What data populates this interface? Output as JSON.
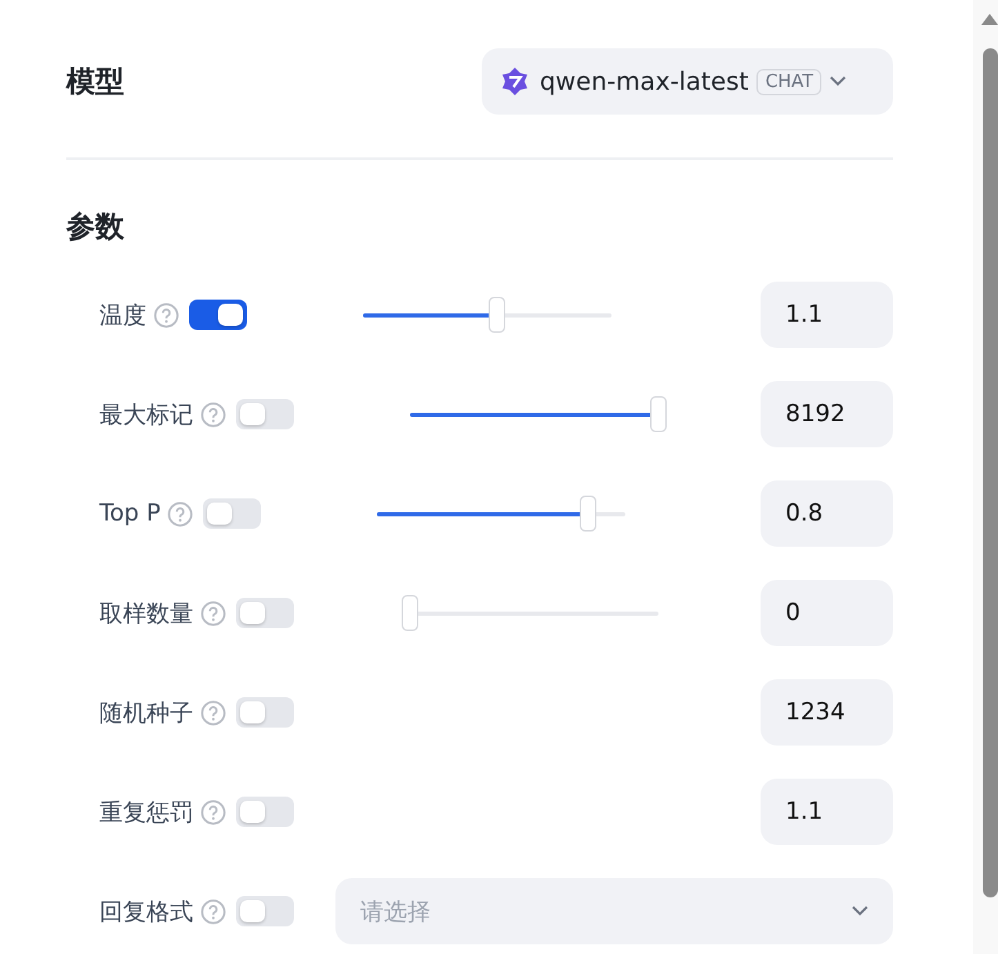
{
  "model": {
    "heading": "模型",
    "name": "qwen-max-latest",
    "tag": "CHAT"
  },
  "params": {
    "heading": "参数",
    "rows": [
      {
        "kind": "slider",
        "label": "温度",
        "on": true,
        "level": 0.54,
        "value": "1.1"
      },
      {
        "kind": "slider",
        "label": "最大标记",
        "on": false,
        "level": 1,
        "value": "8192"
      },
      {
        "kind": "slider",
        "label": "Top P",
        "on": false,
        "level": 0.85,
        "value": "0.8"
      },
      {
        "kind": "slider",
        "label": "取样数量",
        "on": false,
        "level": 0,
        "value": "0"
      },
      {
        "kind": "number",
        "label": "随机种子",
        "on": false,
        "value": "1234"
      },
      {
        "kind": "number",
        "label": "重复惩罚",
        "on": false,
        "value": "1.1"
      },
      {
        "kind": "select",
        "label": "回复格式",
        "on": false,
        "placeholder": "请选择"
      }
    ]
  }
}
